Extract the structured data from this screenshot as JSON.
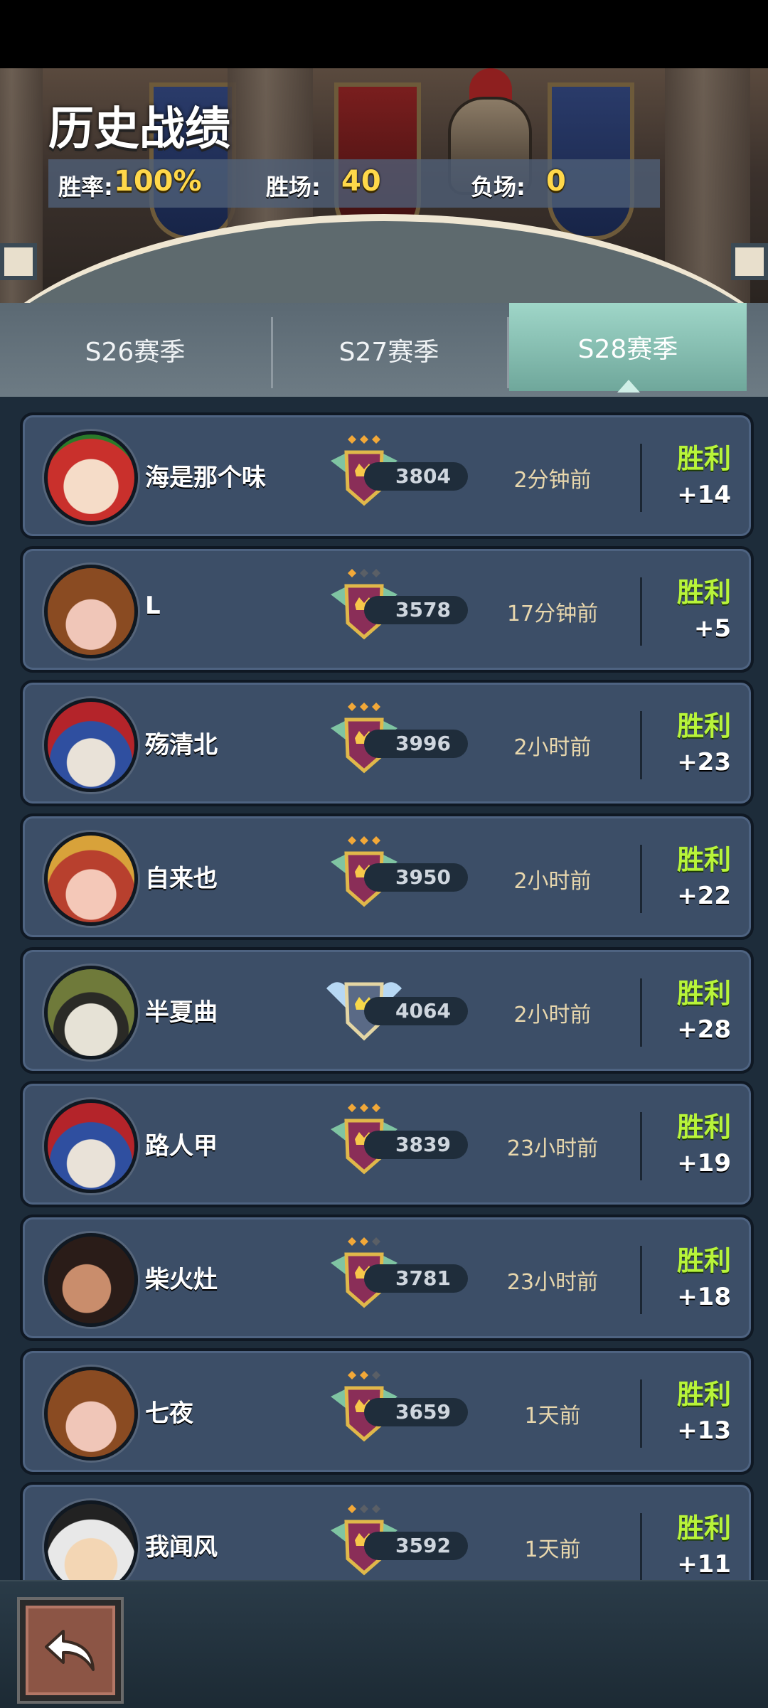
{
  "header": {
    "title": "历史战绩",
    "stats": {
      "win_rate_label": "胜率:",
      "win_rate_value": "100%",
      "wins_label": "胜场:",
      "wins_value": "40",
      "losses_label": "负场:",
      "losses_value": "0"
    }
  },
  "tabs": [
    {
      "label": "S26赛季",
      "selected": false
    },
    {
      "label": "S27赛季",
      "selected": false
    },
    {
      "label": "S28赛季",
      "selected": true
    }
  ],
  "matches": [
    {
      "name": "海是那个味",
      "rating": "3804",
      "time": "2分钟前",
      "result": "胜利",
      "delta": "+14",
      "stars": 3,
      "badge": "crest-badge",
      "avatar": "strawberry-hat-avatar"
    },
    {
      "name": "L",
      "rating": "3578",
      "time": "17分钟前",
      "result": "胜利",
      "delta": "+5",
      "stars": 1,
      "badge": "crest-badge",
      "avatar": "pumpkin-hat-avatar"
    },
    {
      "name": "殇清北",
      "rating": "3996",
      "time": "2小时前",
      "result": "胜利",
      "delta": "+23",
      "stars": 3,
      "badge": "crest-badge",
      "avatar": "jester-hat-avatar"
    },
    {
      "name": "自来也",
      "rating": "3950",
      "time": "2小时前",
      "result": "胜利",
      "delta": "+22",
      "stars": 3,
      "badge": "crest-badge",
      "avatar": "feather-headdress-avatar"
    },
    {
      "name": "半夏曲",
      "rating": "4064",
      "time": "2小时前",
      "result": "胜利",
      "delta": "+28",
      "stars": 0,
      "badge": "winged-crest-badge",
      "avatar": "raccoon-avatar"
    },
    {
      "name": "路人甲",
      "rating": "3839",
      "time": "23小时前",
      "result": "胜利",
      "delta": "+19",
      "stars": 3,
      "badge": "crest-badge",
      "avatar": "jester-hat-avatar"
    },
    {
      "name": "柴火灶",
      "rating": "3781",
      "time": "23小时前",
      "result": "胜利",
      "delta": "+18",
      "stars": 2,
      "badge": "crest-badge",
      "avatar": "dark-avatar"
    },
    {
      "name": "七夜",
      "rating": "3659",
      "time": "1天前",
      "result": "胜利",
      "delta": "+13",
      "stars": 2,
      "badge": "crest-badge",
      "avatar": "pumpkin-hat-avatar"
    },
    {
      "name": "我闻风",
      "rating": "3592",
      "time": "1天前",
      "result": "胜利",
      "delta": "+11",
      "stars": 1,
      "badge": "crest-badge",
      "avatar": "panda-hat-avatar"
    }
  ],
  "colors": {
    "win_text": "#b8f43a",
    "stat_value": "#ffd84a",
    "card_bg": "#3c4e67",
    "tab_selected": "#9fd6c8"
  },
  "bottom": {
    "back_icon": "back-arrow-icon"
  }
}
